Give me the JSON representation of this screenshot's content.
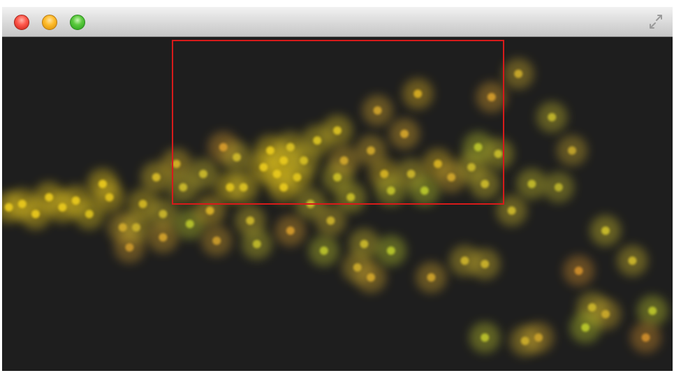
{
  "window": {
    "traffic_lights": [
      "close-button",
      "minimize-button",
      "zoom-button"
    ],
    "fullscreen_icon": "fullscreen-arrows-icon"
  },
  "colors": {
    "background": "#1e1e1e",
    "selection": "#d81a1a",
    "bubble_yellow": "#e5c41a",
    "bubble_olive": "#b5c42a",
    "bubble_orange": "#d08a2a"
  },
  "chart_data": {
    "type": "scatter",
    "title": "",
    "xlabel": "",
    "ylabel": "",
    "xlim": [
      0,
      100
    ],
    "ylim": [
      0,
      100
    ],
    "grid": false,
    "legend": false,
    "selection": {
      "x_range": [
        25.3,
        74.9
      ],
      "y_range": [
        49.6,
        99.0
      ]
    },
    "points": [
      {
        "x": 1,
        "y": 49,
        "c": "#e8c81a"
      },
      {
        "x": 3,
        "y": 50,
        "c": "#e8c81a"
      },
      {
        "x": 5,
        "y": 47,
        "c": "#e8c81a"
      },
      {
        "x": 7,
        "y": 52,
        "c": "#e8c81a"
      },
      {
        "x": 9,
        "y": 49,
        "c": "#e8c81a"
      },
      {
        "x": 11,
        "y": 51,
        "c": "#e8c81a"
      },
      {
        "x": 13,
        "y": 47,
        "c": "#d9bf1f"
      },
      {
        "x": 15,
        "y": 56,
        "c": "#e8c81a"
      },
      {
        "x": 16,
        "y": 52,
        "c": "#e0c01c"
      },
      {
        "x": 18,
        "y": 43,
        "c": "#cfa82a"
      },
      {
        "x": 19,
        "y": 37,
        "c": "#c8962a"
      },
      {
        "x": 20,
        "y": 43,
        "c": "#c9b02a"
      },
      {
        "x": 21,
        "y": 50,
        "c": "#d0b524"
      },
      {
        "x": 23,
        "y": 58,
        "c": "#d6b928"
      },
      {
        "x": 24,
        "y": 47,
        "c": "#c8b42a"
      },
      {
        "x": 24,
        "y": 40,
        "c": "#d0a02a"
      },
      {
        "x": 26,
        "y": 62,
        "c": "#d4b025"
      },
      {
        "x": 27,
        "y": 55,
        "c": "#c9b82c"
      },
      {
        "x": 28,
        "y": 44,
        "c": "#b6c22c"
      },
      {
        "x": 30,
        "y": 59,
        "c": "#c9b82c"
      },
      {
        "x": 31,
        "y": 48,
        "c": "#d8b027"
      },
      {
        "x": 32,
        "y": 39,
        "c": "#c89a2a"
      },
      {
        "x": 33,
        "y": 67,
        "c": "#d49a2a"
      },
      {
        "x": 34,
        "y": 55,
        "c": "#e0c21e"
      },
      {
        "x": 35,
        "y": 64,
        "c": "#cdb82a"
      },
      {
        "x": 36,
        "y": 55,
        "c": "#d9bf20"
      },
      {
        "x": 37,
        "y": 45,
        "c": "#c9b42a"
      },
      {
        "x": 38,
        "y": 38,
        "c": "#bdb72c"
      },
      {
        "x": 39,
        "y": 61,
        "c": "#e7c81a"
      },
      {
        "x": 40,
        "y": 66,
        "c": "#e7c81a"
      },
      {
        "x": 41,
        "y": 59,
        "c": "#e7c81a"
      },
      {
        "x": 42,
        "y": 63,
        "c": "#e7c81a"
      },
      {
        "x": 42,
        "y": 55,
        "c": "#e7c81a"
      },
      {
        "x": 43,
        "y": 67,
        "c": "#d9c020"
      },
      {
        "x": 43,
        "y": 42,
        "c": "#d0982a"
      },
      {
        "x": 44,
        "y": 58,
        "c": "#e0c41e"
      },
      {
        "x": 45,
        "y": 63,
        "c": "#d4bd22"
      },
      {
        "x": 46,
        "y": 50,
        "c": "#c9b82a"
      },
      {
        "x": 47,
        "y": 69,
        "c": "#d8c120"
      },
      {
        "x": 48,
        "y": 36,
        "c": "#b8c02c"
      },
      {
        "x": 49,
        "y": 45,
        "c": "#c8ae2a"
      },
      {
        "x": 50,
        "y": 72,
        "c": "#d9c020"
      },
      {
        "x": 50,
        "y": 58,
        "c": "#c9bd26"
      },
      {
        "x": 51,
        "y": 63,
        "c": "#cfa62a"
      },
      {
        "x": 52,
        "y": 52,
        "c": "#c6bc28"
      },
      {
        "x": 53,
        "y": 31,
        "c": "#c9a82a"
      },
      {
        "x": 54,
        "y": 38,
        "c": "#c7b52a"
      },
      {
        "x": 55,
        "y": 66,
        "c": "#cda62a"
      },
      {
        "x": 55,
        "y": 28,
        "c": "#cfa42a"
      },
      {
        "x": 56,
        "y": 78,
        "c": "#cca02a"
      },
      {
        "x": 57,
        "y": 59,
        "c": "#d2b024"
      },
      {
        "x": 58,
        "y": 54,
        "c": "#bfbf2a"
      },
      {
        "x": 58,
        "y": 36,
        "c": "#b5c42c"
      },
      {
        "x": 60,
        "y": 71,
        "c": "#d0a22a"
      },
      {
        "x": 61,
        "y": 59,
        "c": "#c9b42a"
      },
      {
        "x": 62,
        "y": 83,
        "c": "#d4aa24"
      },
      {
        "x": 63,
        "y": 54,
        "c": "#b8c62a"
      },
      {
        "x": 64,
        "y": 28,
        "c": "#cba02a"
      },
      {
        "x": 65,
        "y": 62,
        "c": "#d6b022"
      },
      {
        "x": 67,
        "y": 58,
        "c": "#cfa52a"
      },
      {
        "x": 69,
        "y": 33,
        "c": "#c9b02a"
      },
      {
        "x": 70,
        "y": 61,
        "c": "#c7b62a"
      },
      {
        "x": 71,
        "y": 67,
        "c": "#b9c32c"
      },
      {
        "x": 72,
        "y": 56,
        "c": "#c9b82a"
      },
      {
        "x": 73,
        "y": 82,
        "c": "#d09a2a"
      },
      {
        "x": 74,
        "y": 65,
        "c": "#c6bb2a"
      },
      {
        "x": 72,
        "y": 32,
        "c": "#c9b02a"
      },
      {
        "x": 76,
        "y": 48,
        "c": "#c9b52a"
      },
      {
        "x": 77,
        "y": 89,
        "c": "#c8a82a"
      },
      {
        "x": 79,
        "y": 56,
        "c": "#c1b92a"
      },
      {
        "x": 82,
        "y": 76,
        "c": "#bfb42a"
      },
      {
        "x": 83,
        "y": 55,
        "c": "#b8b02a"
      },
      {
        "x": 85,
        "y": 66,
        "c": "#c0a22a"
      },
      {
        "x": 86,
        "y": 30,
        "c": "#cc8c2a"
      },
      {
        "x": 90,
        "y": 42,
        "c": "#c9bb2a"
      },
      {
        "x": 94,
        "y": 33,
        "c": "#c9b42a"
      },
      {
        "x": 88,
        "y": 19,
        "c": "#c9b42a"
      },
      {
        "x": 90,
        "y": 17,
        "c": "#c9a82a"
      },
      {
        "x": 87,
        "y": 13,
        "c": "#b9c82a"
      },
      {
        "x": 80,
        "y": 10,
        "c": "#c9a02a"
      },
      {
        "x": 78,
        "y": 9,
        "c": "#c9aa2a"
      },
      {
        "x": 72,
        "y": 10,
        "c": "#b9c02a"
      },
      {
        "x": 97,
        "y": 18,
        "c": "#b9c22a"
      },
      {
        "x": 96,
        "y": 10,
        "c": "#cc8c2a"
      }
    ]
  }
}
